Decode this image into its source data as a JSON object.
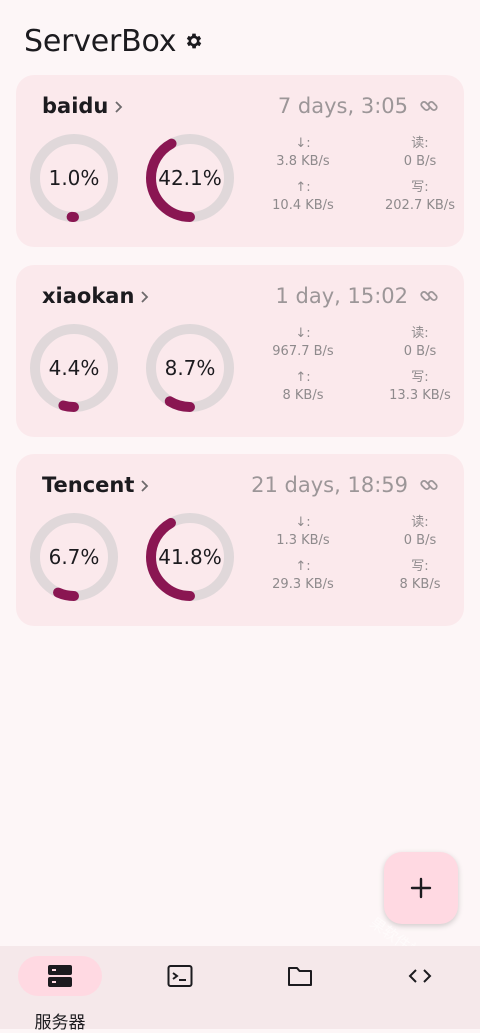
{
  "app": {
    "title": "ServerBox"
  },
  "servers": [
    {
      "name": "baidu",
      "uptime": "7 days, 3:05",
      "cpu_percent": 1.0,
      "cpu_label": "1.0%",
      "mem_percent": 42.1,
      "mem_label": "42.1%",
      "net_down_label": "↓:",
      "net_down": "3.8 KB/s",
      "net_up_label": "↑:",
      "net_up": "10.4 KB/s",
      "disk_read_label": "读:",
      "disk_read": "0 B/s",
      "disk_write_label": "写:",
      "disk_write": "202.7 KB/s"
    },
    {
      "name": "xiaokan",
      "uptime": "1 day, 15:02",
      "cpu_percent": 4.4,
      "cpu_label": "4.4%",
      "mem_percent": 8.7,
      "mem_label": "8.7%",
      "net_down_label": "↓:",
      "net_down": "967.7 B/s",
      "net_up_label": "↑:",
      "net_up": "8 KB/s",
      "disk_read_label": "读:",
      "disk_read": "0 B/s",
      "disk_write_label": "写:",
      "disk_write": "13.3 KB/s"
    },
    {
      "name": "Tencent",
      "uptime": "21 days, 18:59",
      "cpu_percent": 6.7,
      "cpu_label": "6.7%",
      "mem_percent": 41.8,
      "mem_label": "41.8%",
      "net_down_label": "↓:",
      "net_down": "1.3 KB/s",
      "net_up_label": "↑:",
      "net_up": "29.3 KB/s",
      "disk_read_label": "读:",
      "disk_read": "0 B/s",
      "disk_write_label": "写:",
      "disk_write": "8 KB/s"
    }
  ],
  "nav": {
    "items": [
      {
        "label": "服务器",
        "icon": "server-icon",
        "active": true
      },
      {
        "label": "",
        "icon": "terminal-icon",
        "active": false
      },
      {
        "label": "",
        "icon": "folder-icon",
        "active": false
      },
      {
        "label": "",
        "icon": "code-icon",
        "active": false
      }
    ]
  },
  "fab": {
    "icon": "plus-icon"
  },
  "watermark": "果软件站",
  "colors": {
    "accent": "#8a1652",
    "track": "#e0d8da",
    "card": "#fbe9ec",
    "background": "#fdf6f7"
  }
}
